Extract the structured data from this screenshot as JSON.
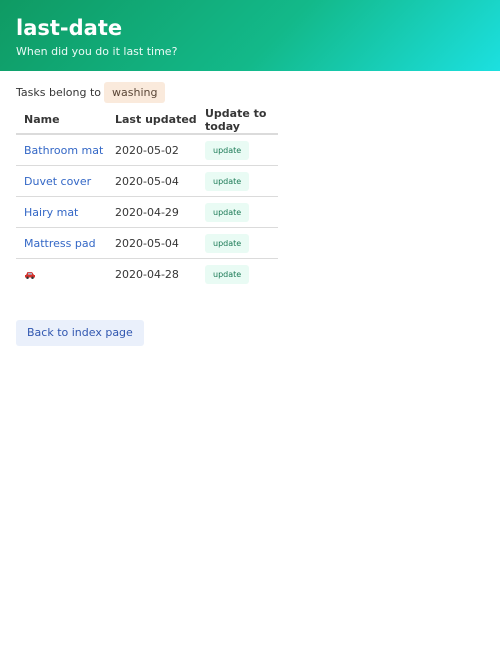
{
  "header": {
    "title": "last-date",
    "subtitle": "When did you do it last time?"
  },
  "category": {
    "label": "Tasks belong to",
    "name": "washing"
  },
  "table": {
    "columns": [
      "Name",
      "Last updated",
      "Update to today"
    ],
    "rows": [
      {
        "name": "Bathroom mat",
        "last_updated": "2020-05-02",
        "action": "update",
        "icon": ""
      },
      {
        "name": "Duvet cover",
        "last_updated": "2020-05-04",
        "action": "update",
        "icon": ""
      },
      {
        "name": "Hairy mat",
        "last_updated": "2020-04-29",
        "action": "update",
        "icon": ""
      },
      {
        "name": "Mattress pad",
        "last_updated": "2020-05-04",
        "action": "update",
        "icon": ""
      },
      {
        "name": "",
        "last_updated": "2020-04-28",
        "action": "update",
        "icon": "red-car-icon"
      }
    ]
  },
  "footer": {
    "back_label": "Back to index page"
  },
  "colors": {
    "accent": "#13b98a",
    "link": "#3367c6",
    "car": "#d6312b"
  }
}
